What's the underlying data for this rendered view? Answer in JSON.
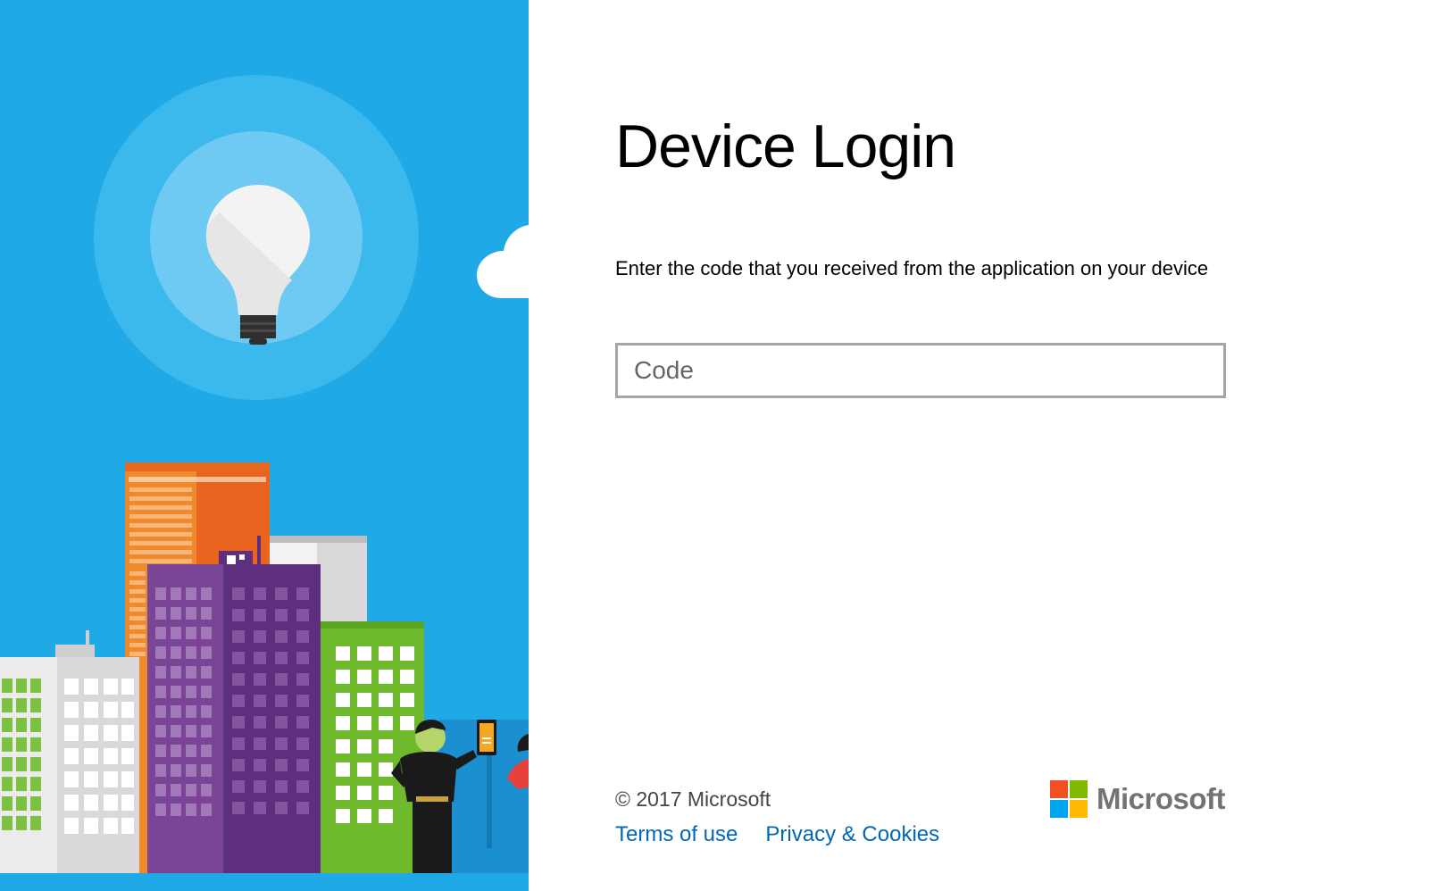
{
  "login": {
    "title": "Device Login",
    "instruction": "Enter the code that you received from the application on your device",
    "code_input": {
      "value": "",
      "placeholder": "Code"
    }
  },
  "footer": {
    "copyright": "© 2017 Microsoft",
    "links": {
      "terms": "Terms of use",
      "privacy": "Privacy & Cookies"
    },
    "logo_text": "Microsoft"
  },
  "colors": {
    "sky_blue": "#1fa9e6",
    "link_blue": "#0067b8",
    "logo_red": "#f25022",
    "logo_green": "#7fba00",
    "logo_blue": "#00a4ef",
    "logo_yellow": "#ffb900"
  }
}
